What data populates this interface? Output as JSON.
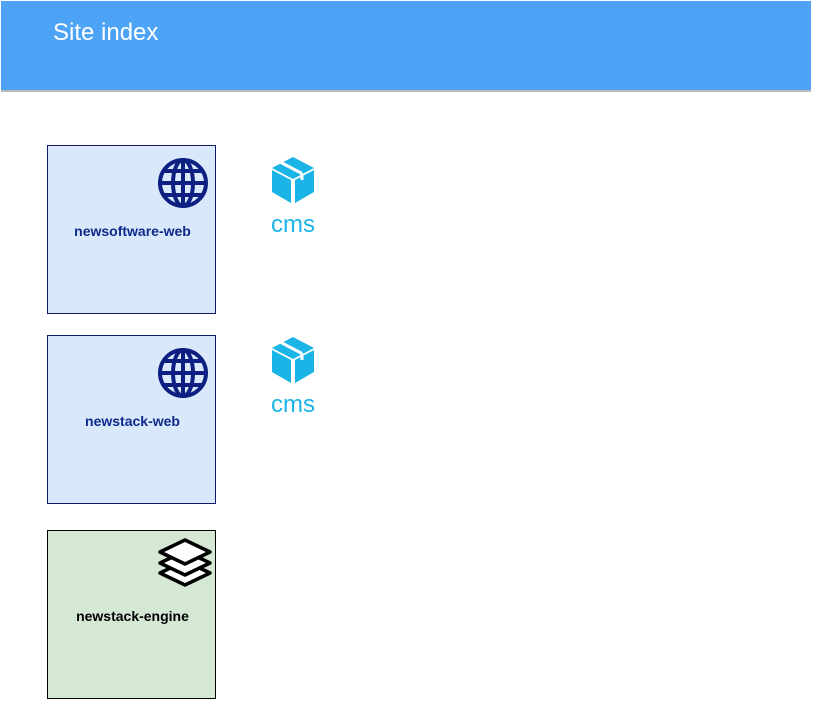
{
  "header": {
    "title": "Site index",
    "color": "#4da3f5"
  },
  "nodes": [
    {
      "label": "newsoftware-web",
      "icon": "globe-icon",
      "fill": "#dae8fc"
    },
    {
      "label": "newstack-web",
      "icon": "globe-icon",
      "fill": "#dae8fc"
    },
    {
      "label": "newstack-engine",
      "icon": "layers-icon",
      "fill": "#d5e8d4"
    }
  ],
  "services": [
    {
      "label": "cms",
      "icon": "package-icon",
      "color": "#1ab4e6"
    },
    {
      "label": "cms",
      "icon": "package-icon",
      "color": "#1ab4e6"
    }
  ]
}
